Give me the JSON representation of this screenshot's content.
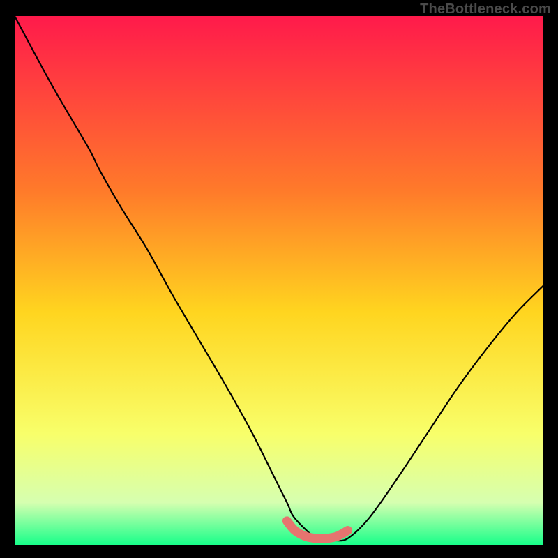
{
  "watermark": "TheBottleneck.com",
  "colors": {
    "bg": "#000000",
    "curve": "#000000",
    "accent": "#e6746f",
    "grad_top": "#ff1a4b",
    "grad_mid1": "#ff7a2a",
    "grad_mid2": "#ffd51f",
    "grad_mid3": "#f8ff6a",
    "grad_mid4": "#d6ffb0",
    "grad_bot": "#18ff8a",
    "watermark": "#4a4a4a"
  },
  "chart_data": {
    "type": "line",
    "title": "",
    "xlabel": "",
    "ylabel": "",
    "xlim": [
      0,
      100
    ],
    "ylim": [
      0,
      100
    ],
    "series": [
      {
        "name": "bottleneck-curve",
        "x": [
          0,
          7,
          14,
          16,
          20,
          25,
          30,
          35,
          40,
          45,
          49,
          51.5,
          53,
          57,
          59,
          60.5,
          63,
          67,
          72,
          78,
          84,
          90,
          95,
          100
        ],
        "y": [
          100,
          87,
          75,
          71,
          64,
          56,
          47,
          38.5,
          30,
          21,
          13,
          8,
          5,
          1.2,
          0.8,
          0.8,
          1.2,
          5,
          12,
          21,
          30,
          38,
          44,
          49
        ]
      },
      {
        "name": "accent-flat",
        "x": [
          51.5,
          53,
          55,
          57,
          59,
          61,
          63
        ],
        "y": [
          4.5,
          2.7,
          1.6,
          1.2,
          1.2,
          1.6,
          2.7
        ]
      }
    ]
  }
}
